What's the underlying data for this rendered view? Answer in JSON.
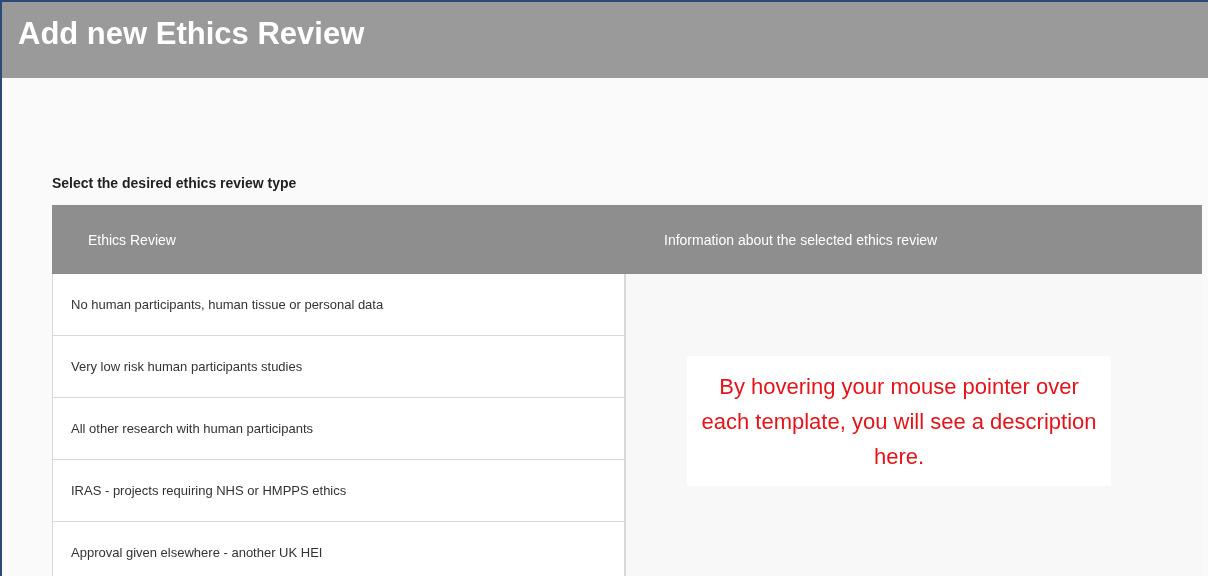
{
  "header": {
    "title": "Add new Ethics Review"
  },
  "prompt": "Select the desired ethics review type",
  "table": {
    "columns": [
      "Ethics Review",
      "Information about the selected ethics review"
    ],
    "rows": [
      "No human participants, human tissue or personal data",
      "Very low risk human participants studies",
      "All other research with human participants",
      "IRAS - projects requiring NHS or HMPPS ethics",
      "Approval given elsewhere - another UK HEI"
    ],
    "info": "By hovering your mouse pointer over each template, you will see a description here."
  }
}
